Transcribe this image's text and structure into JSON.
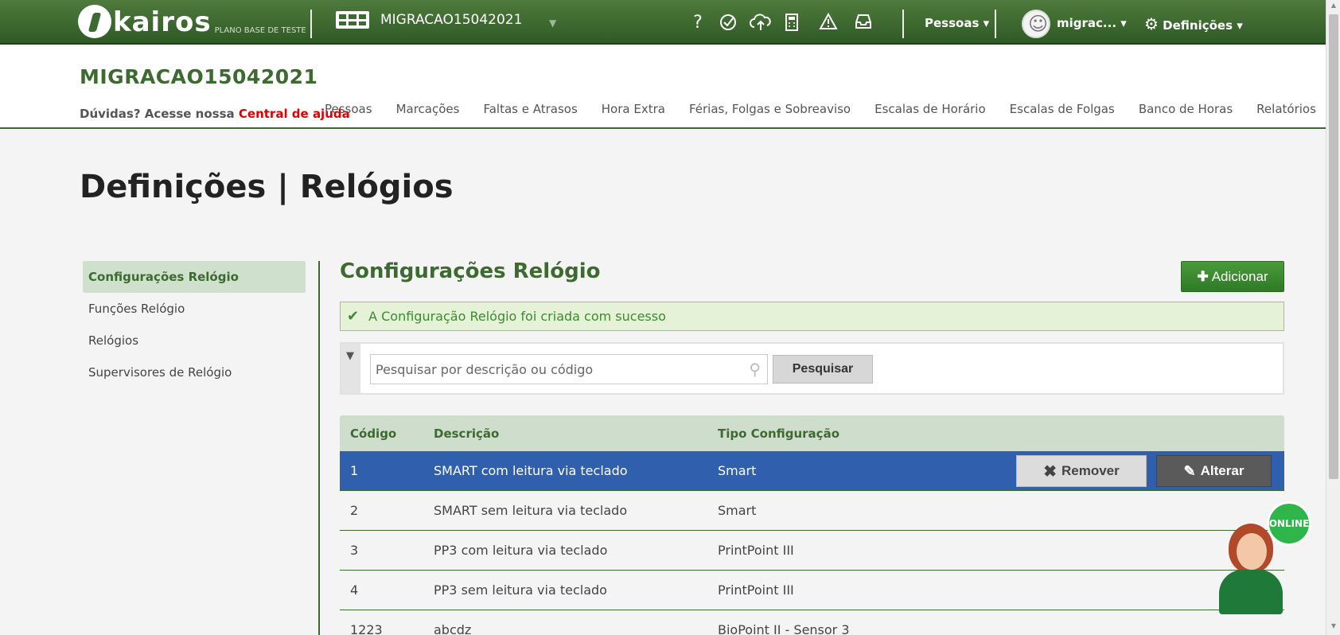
{
  "topbar": {
    "logo_text": "kairos",
    "logo_subtitle": "PLANO BASE DE TESTE",
    "company_selector": "MIGRACAO15042021",
    "icons": [
      "help-icon",
      "clock-check-icon",
      "cloud-upload-icon",
      "calculator-icon",
      "warning-icon",
      "inbox-icon"
    ],
    "pessoas_menu": "Pessoas",
    "user_name": "migrac...",
    "settings_menu": "Definições"
  },
  "header": {
    "company_title": "MIGRACAO15042021",
    "help_text": "Dúvidas? Acesse nossa",
    "help_link": "Central de ajuda",
    "nav": [
      "Pessoas",
      "Marcações",
      "Faltas e Atrasos",
      "Hora Extra",
      "Férias, Folgas e Sobreaviso",
      "Escalas de Horário",
      "Escalas de Folgas",
      "Banco de Horas",
      "Relatórios"
    ]
  },
  "page_title": "Definições | Relógios",
  "sidebar": {
    "items": [
      {
        "label": "Configurações Relógio",
        "active": true
      },
      {
        "label": "Funções Relógio",
        "active": false
      },
      {
        "label": "Relógios",
        "active": false
      },
      {
        "label": "Supervisores de Relógio",
        "active": false
      }
    ]
  },
  "content": {
    "section_title": "Configurações Relógio",
    "add_button": "Adicionar",
    "success_message": "A Configuração Relógio foi criada com sucesso",
    "search": {
      "placeholder": "Pesquisar por descrição ou código",
      "value": "",
      "button": "Pesquisar"
    }
  },
  "table": {
    "headers": [
      "Código",
      "Descrição",
      "Tipo Configuração"
    ],
    "rows": [
      {
        "codigo": "1",
        "descricao": "SMART com leitura via teclado",
        "tipo": "Smart"
      },
      {
        "codigo": "2",
        "descricao": "SMART sem leitura via teclado",
        "tipo": "Smart"
      },
      {
        "codigo": "3",
        "descricao": "PP3 com leitura via teclado",
        "tipo": "PrintPoint III"
      },
      {
        "codigo": "4",
        "descricao": "PP3 sem leitura via teclado",
        "tipo": "PrintPoint III"
      },
      {
        "codigo": "1223",
        "descricao": "abcdz",
        "tipo": "BioPoint II - Sensor 3"
      }
    ],
    "selected_row": 0,
    "remove_button": "Remover",
    "edit_button": "Alterar"
  },
  "online_widget": {
    "label": "ONLINE"
  },
  "colors": {
    "brand_green": "#3d6a30",
    "selected_row": "#2f5fad",
    "help_link": "#e00000",
    "success_bg": "#e6f2d8",
    "add_button": "#2f7a26"
  }
}
